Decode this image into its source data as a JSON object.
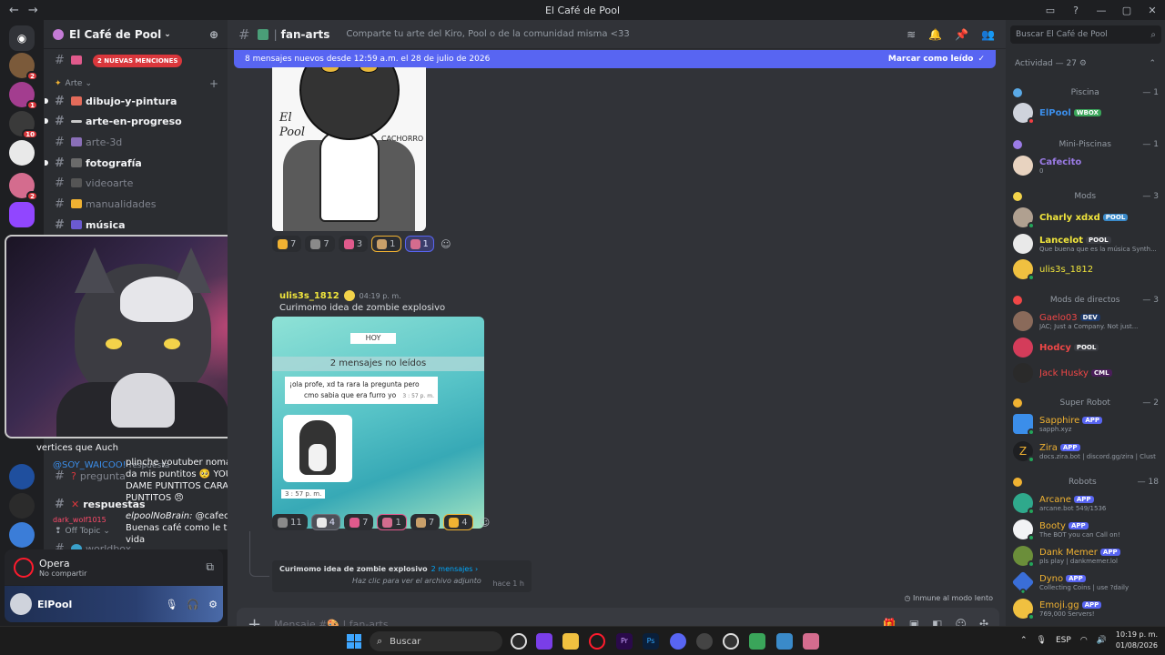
{
  "window": {
    "title": "El Café de Pool",
    "back_icon": "←",
    "forward_icon": "→"
  },
  "server_badges": [
    "2",
    "1",
    "10",
    "2"
  ],
  "guild": {
    "name": "El Café de Pool",
    "mentions_pill": "2 NUEVAS MENCIONES",
    "category_arte": "Arte",
    "category_off": "Off Topic",
    "channels": [
      {
        "name": "dibujo-y-pintura",
        "unread": true
      },
      {
        "name": "arte-en-progreso",
        "unread": true
      },
      {
        "name": "arte-3d",
        "unread": false
      },
      {
        "name": "fotografía",
        "unread": true
      },
      {
        "name": "videoarte",
        "unread": false
      },
      {
        "name": "manualidades",
        "unread": false
      },
      {
        "name": "música",
        "unread": true
      },
      {
        "name": "pregunta",
        "unread": false
      },
      {
        "name": "respuestas",
        "unread": true
      },
      {
        "name": "worldbox",
        "unread": false
      }
    ]
  },
  "stream_chat": {
    "line1": "vertices que Auch",
    "line2": "plinche youtuber nomás no me da mis puntitos 🥺 YOUTUBE DAME PUNTITOS CARAJO DAME PUNTITOS 😠",
    "author2": "@SOY_WAICOO!",
    "author2_suffix": "respuesta",
    "author3": "dark_wolf1015",
    "author3_handle": "elpoolNoBrain:",
    "line3": "@cafecitouwu0 Buenas café como le trata la vida"
  },
  "voice": {
    "title": "Opera",
    "subtitle": "No compartir"
  },
  "user": {
    "name": "ElPool"
  },
  "channel": {
    "name": "fan-arts",
    "topic": "Comparte tu arte del Kiro, Pool o de la comunidad misma <33",
    "new_messages_bar": "8 mensajes nuevos desde 12:59 a.m. el 28 de julio de 2026",
    "mark_read": "Marcar como leído",
    "composer_placeholder": "Mensaje #🎨 | fan-arts"
  },
  "image1": {
    "signature": "El\nPool",
    "label": "CACHORRO"
  },
  "reactions1": [
    "7",
    "7",
    "3",
    "1",
    "1"
  ],
  "message": {
    "author": "ulis3s_1812",
    "time": "04:19 p. m.",
    "text": "Curimomo idea de zombie explosivo"
  },
  "image2": {
    "day": "HOY",
    "unread": "2 mensajes no leídos",
    "bubble_line1": "¡ola profe, xd ta rara la pregunta pero",
    "bubble_line2": "cmo sabia que era furro yo",
    "bubble_time": "3 : 57 p. m.",
    "sticker_time": "3 : 57 p. m."
  },
  "reactions2": [
    "11",
    "4",
    "7",
    "1",
    "7",
    "4"
  ],
  "thread": {
    "title": "Curimomo idea de zombie explosivo",
    "count": "2 mensajes ›",
    "preview": "Haz clic para ver el archivo adjunto",
    "ago": "hace 1 h"
  },
  "slowmode": "Inmune al modo lento",
  "members": {
    "search_placeholder": "Buscar El Café de Pool",
    "activity_header": "Actividad — 27",
    "groups": [
      {
        "name": "Piscina",
        "count": "— 1",
        "color": "#5aa9e6"
      },
      {
        "name": "Mini-Piscinas",
        "count": "— 1",
        "color": "#9b7be6"
      },
      {
        "name": "Mods",
        "count": "— 3",
        "color": "#f3d34a"
      },
      {
        "name": "Mods de directos",
        "count": "— 3",
        "color": "#f04747"
      },
      {
        "name": "Super Robot",
        "count": "— 2",
        "color": "#f0b232"
      },
      {
        "name": "Robots",
        "count": "— 18",
        "color": "#f0b232"
      }
    ],
    "list": [
      {
        "name": "ElPool",
        "color": "#3b8eea",
        "tag": "WBOX",
        "activity": ""
      },
      {
        "name": "Cafecito",
        "color": "#9b7be6",
        "tag": "",
        "activity": "0"
      },
      {
        "name": "Charly xdxd",
        "color": "#f0e53c",
        "tag": "POOL",
        "activity": ""
      },
      {
        "name": "Lancelot",
        "color": "#f0e53c",
        "tag": "POOL",
        "activity": "Que buena que es la música Synth..."
      },
      {
        "name": "ulis3s_1812",
        "color": "#f0e53c",
        "tag": "",
        "activity": ""
      },
      {
        "name": "Gaelo03",
        "color": "#f04747",
        "tag": "DEV",
        "activity": "JAC; Just a Company. Not just..."
      },
      {
        "name": "Hodcy",
        "color": "#f04747",
        "tag": "POOL",
        "activity": ""
      },
      {
        "name": "Jack Husky",
        "color": "#f04747",
        "tag": "CML",
        "activity": ""
      },
      {
        "name": "Sapphire",
        "color": "#f0b232",
        "tag": "APP",
        "activity": "sapph.xyz"
      },
      {
        "name": "Zira",
        "color": "#f0b232",
        "tag": "APP",
        "activity": "docs.zira.bot | discord.gg/zira | Clust"
      },
      {
        "name": "Arcane",
        "color": "#f0b232",
        "tag": "APP",
        "activity": "arcane.bot 549/1536"
      },
      {
        "name": "Booty",
        "color": "#f0b232",
        "tag": "APP",
        "activity": "The BOT you can Call on!"
      },
      {
        "name": "Dank Memer",
        "color": "#f0b232",
        "tag": "APP",
        "activity": "pls play | dankmemer.lol"
      },
      {
        "name": "Dyno",
        "color": "#f0b232",
        "tag": "APP",
        "activity": "Collecting Coins | use ?daily"
      },
      {
        "name": "Emoji.gg",
        "color": "#f0b232",
        "tag": "APP",
        "activity": "769,000 Servers!"
      }
    ]
  },
  "taskbar": {
    "search": "Buscar",
    "lang": "ESP",
    "time": "10:19 p. m.",
    "date": "01/08/2026"
  }
}
